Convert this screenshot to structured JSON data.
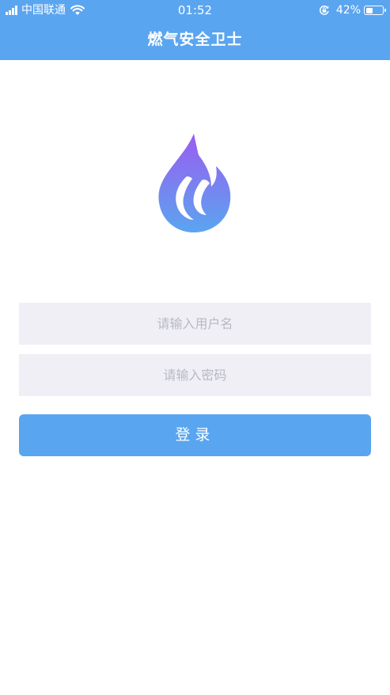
{
  "status_bar": {
    "carrier": "中国联通",
    "time": "01:52",
    "battery_percent_text": "42%",
    "battery_level": 0.42,
    "signal_icon": "signal-bars-icon",
    "wifi_icon": "wifi-icon",
    "rotation_icon": "rotation-lock-icon",
    "battery_icon": "battery-icon"
  },
  "nav": {
    "title": "燃气安全卫士"
  },
  "logo": {
    "icon": "flame-drop-logo-icon",
    "gradient_top": "#9b5cf0",
    "gradient_bottom": "#5aa5f0"
  },
  "form": {
    "username_placeholder": "请输入用户名",
    "username_value": "",
    "password_placeholder": "请输入密码",
    "password_value": "",
    "login_label": "登录"
  },
  "colors": {
    "primary": "#5aa5f0",
    "input_bg": "#efeff5",
    "placeholder": "#b9b9c2"
  }
}
